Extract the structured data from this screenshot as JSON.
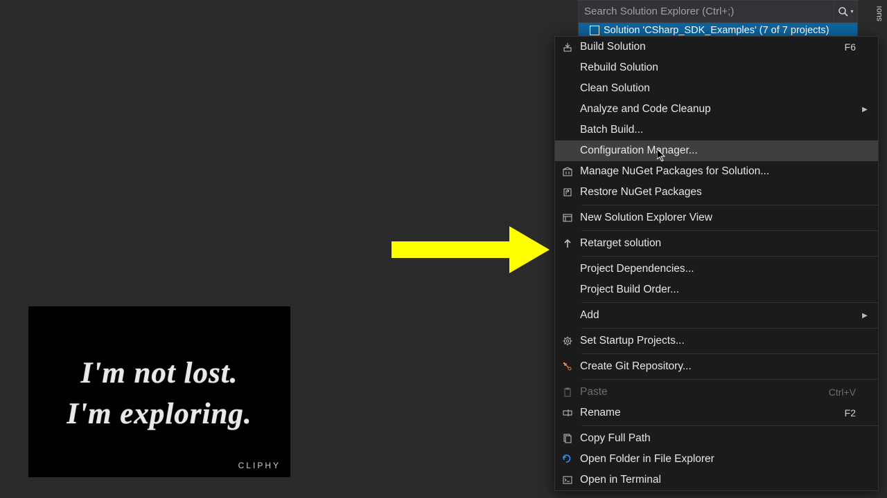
{
  "explorer": {
    "search_placeholder": "Search Solution Explorer (Ctrl+;)",
    "solution_label": "Solution 'CSharp_SDK_Examples' (7 of 7 projects)"
  },
  "vtab_label": "suoı",
  "context_menu": {
    "items": [
      {
        "icon": "build-icon",
        "label": "Build Solution",
        "shortcut": "F6"
      },
      {
        "label": "Rebuild Solution"
      },
      {
        "label": "Clean Solution"
      },
      {
        "label": "Analyze and Code Cleanup",
        "submenu": true
      },
      {
        "label": "Batch Build..."
      },
      {
        "label": "Configuration Manager...",
        "hover": true
      },
      {
        "icon": "nuget-icon",
        "label": "Manage NuGet Packages for Solution..."
      },
      {
        "icon": "restore-icon",
        "label": "Restore NuGet Packages"
      },
      {
        "sep": true
      },
      {
        "icon": "view-icon",
        "label": "New Solution Explorer View"
      },
      {
        "sep": true
      },
      {
        "icon": "retarget-icon",
        "label": "Retarget solution"
      },
      {
        "sep": true
      },
      {
        "label": "Project Dependencies..."
      },
      {
        "label": "Project Build Order..."
      },
      {
        "sep": true
      },
      {
        "label": "Add",
        "submenu": true
      },
      {
        "sep": true
      },
      {
        "icon": "gear-icon",
        "label": "Set Startup Projects..."
      },
      {
        "sep": true
      },
      {
        "icon": "git-icon",
        "label": "Create Git Repository..."
      },
      {
        "sep": true
      },
      {
        "icon": "paste-icon",
        "label": "Paste",
        "shortcut": "Ctrl+V",
        "disabled": true
      },
      {
        "icon": "rename-icon",
        "label": "Rename",
        "shortcut": "F2"
      },
      {
        "sep": true
      },
      {
        "icon": "copypath-icon",
        "label": "Copy Full Path"
      },
      {
        "icon": "folder-open-icon",
        "label": "Open Folder in File Explorer"
      },
      {
        "icon": "terminal-icon",
        "label": "Open in Terminal"
      }
    ]
  },
  "quote": {
    "line1": "I'm not lost.",
    "line2": "I'm exploring.",
    "brand": "CLIPHY"
  }
}
